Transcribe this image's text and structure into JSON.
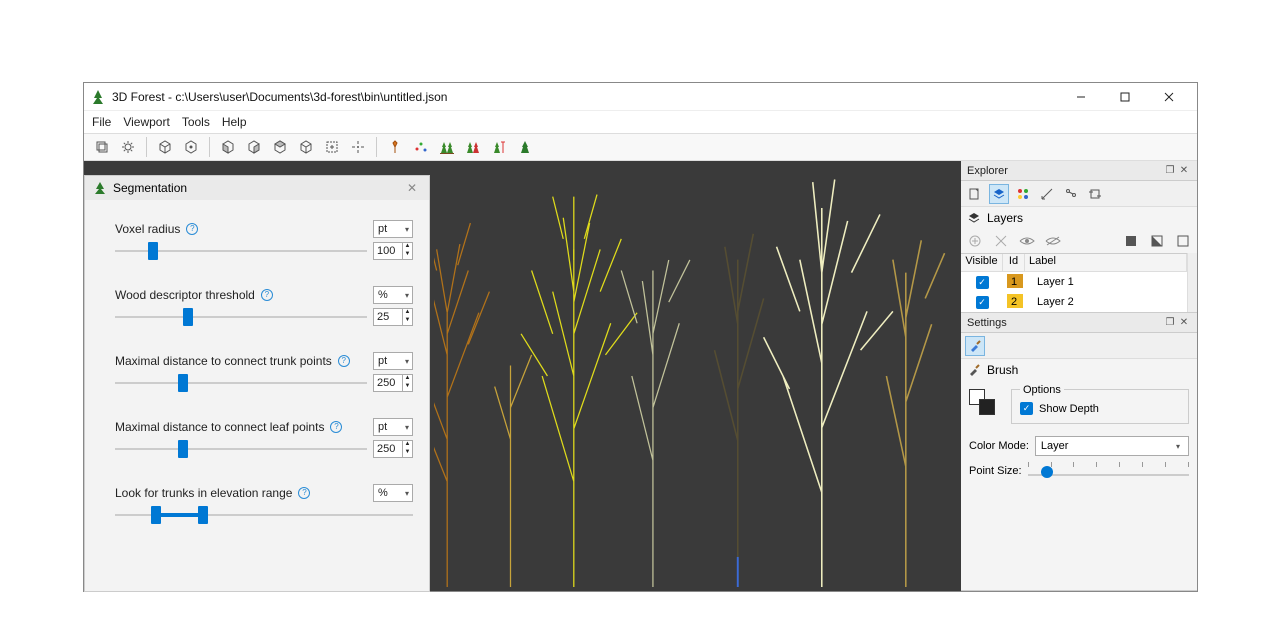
{
  "title": "3D Forest - c:\\Users\\user\\Documents\\3d-forest\\bin\\untitled.json",
  "menu": {
    "file": "File",
    "viewport": "Viewport",
    "tools": "Tools",
    "help": "Help"
  },
  "segmentation": {
    "title": "Segmentation",
    "params": {
      "voxel_radius": {
        "label": "Voxel radius",
        "unit": "pt",
        "value": 100,
        "slider_pct": 13
      },
      "wood_thresh": {
        "label": "Wood descriptor threshold",
        "unit": "%",
        "value": 25,
        "slider_pct": 27
      },
      "trunk_dist": {
        "label": "Maximal distance to connect trunk points",
        "unit": "pt",
        "value": 250,
        "slider_pct": 25
      },
      "leaf_dist": {
        "label": "Maximal distance to connect leaf points",
        "unit": "pt",
        "value": 250,
        "slider_pct": 25
      },
      "elev_range": {
        "label": "Look for trunks in elevation range",
        "unit": "%",
        "lo_pct": 12,
        "hi_pct": 28
      }
    }
  },
  "explorer": {
    "title": "Explorer",
    "section": "Layers",
    "headers": {
      "visible": "Visible",
      "id": "Id",
      "label": "Label"
    },
    "rows": [
      {
        "visible": true,
        "id": "1",
        "color": "#d8981e",
        "label": "Layer 1"
      },
      {
        "visible": true,
        "id": "2",
        "color": "#f4c326",
        "label": "Layer 2"
      }
    ]
  },
  "settings": {
    "title": "Settings",
    "brush": "Brush",
    "options_label": "Options",
    "show_depth_label": "Show Depth",
    "show_depth": true,
    "color_mode_label": "Color Mode:",
    "color_mode_value": "Layer",
    "point_size_label": "Point Size:",
    "point_size_pct": 8
  }
}
